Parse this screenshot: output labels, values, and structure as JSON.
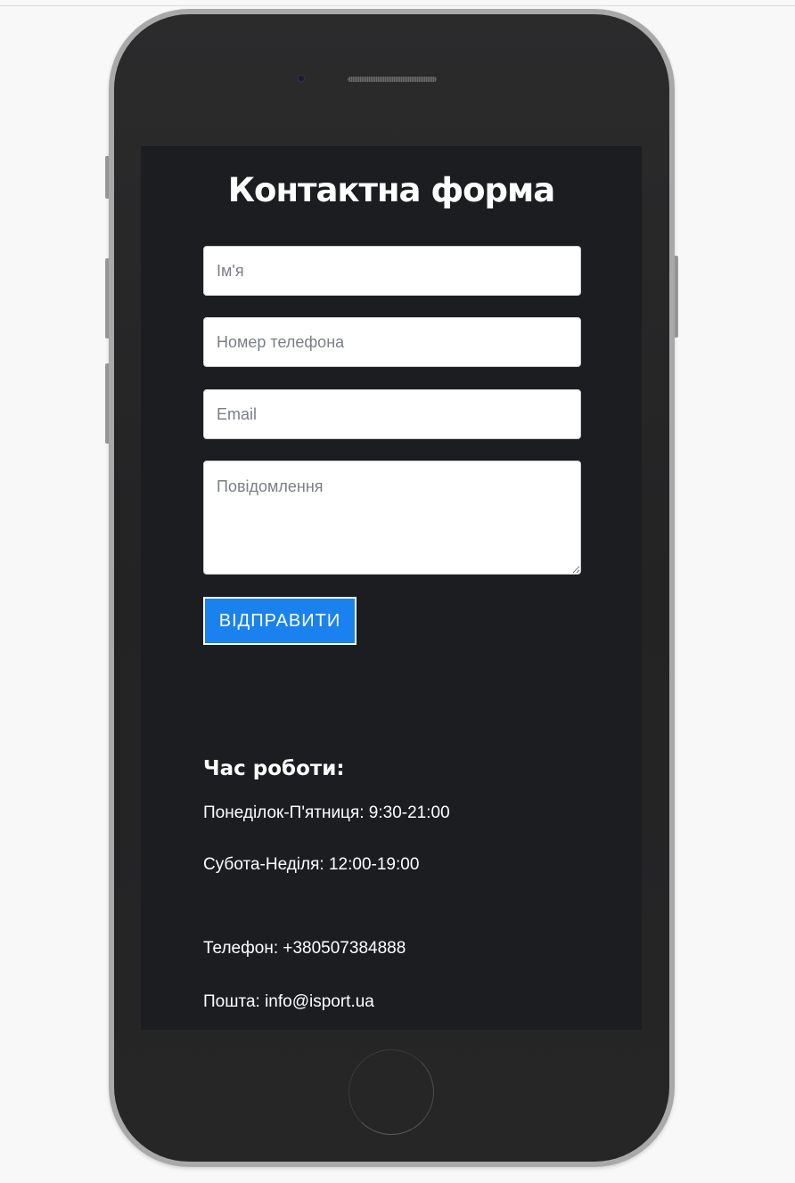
{
  "form": {
    "title": "Контактна форма",
    "name_placeholder": "Ім'я",
    "phone_placeholder": "Номер телефона",
    "email_placeholder": "Email",
    "message_placeholder": "Повідомлення",
    "submit_label": "ВІДПРАВИТИ"
  },
  "info": {
    "hours_title": "Час роботи:",
    "weekdays": "Понеділок-П'ятниця: 9:30-21:00",
    "weekend": "Субота-Неділя: 12:00-19:00",
    "phone": "Телефон: +380507384888",
    "email": "Пошта: info@isport.ua"
  },
  "colors": {
    "screen_bg": "#1c1d21",
    "button_bg": "#1a82ef",
    "phone_body": "#2b2b2c"
  }
}
